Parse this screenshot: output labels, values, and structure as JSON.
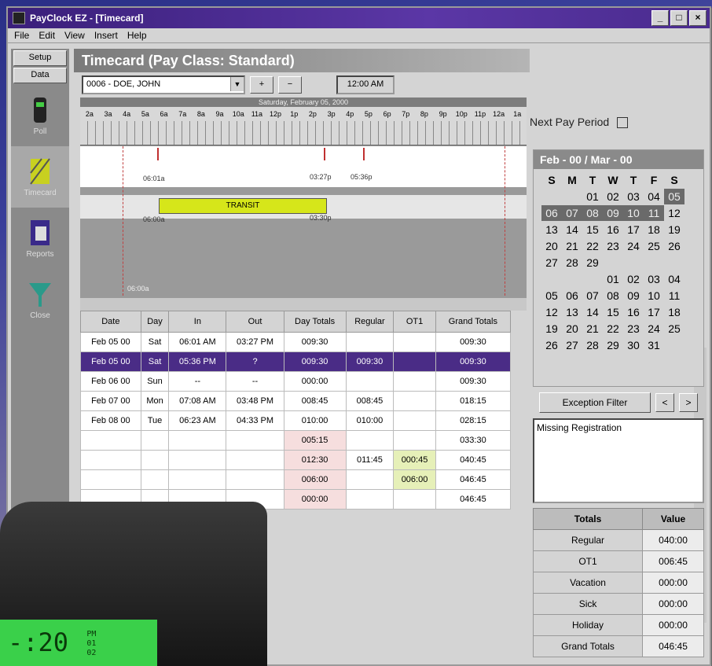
{
  "window": {
    "title": "PayClock EZ - [Timecard]"
  },
  "menu": [
    "File",
    "Edit",
    "View",
    "Insert",
    "Help"
  ],
  "nav": {
    "setup": "Setup",
    "data": "Data",
    "items": [
      {
        "label": "Poll",
        "icon": "clock-device-icon"
      },
      {
        "label": "Timecard",
        "icon": "timecard-icon"
      },
      {
        "label": "Reports",
        "icon": "reports-icon"
      },
      {
        "label": "Close",
        "icon": "close-funnel-icon"
      }
    ]
  },
  "panel": {
    "title": "Timecard (Pay Class: Standard)",
    "employee": "0006 - DOE, JOHN",
    "add_btn": "+",
    "remove_btn": "−",
    "time": "12:00 AM",
    "next_pay_period": "Next Pay Period"
  },
  "timeline": {
    "date": "Saturday, February 05, 2000",
    "hours": [
      "2a",
      "3a",
      "4a",
      "5a",
      "6a",
      "7a",
      "8a",
      "9a",
      "10a",
      "11a",
      "12p",
      "1p",
      "2p",
      "3p",
      "4p",
      "5p",
      "6p",
      "7p",
      "8p",
      "9p",
      "10p",
      "11p",
      "12a",
      "1a"
    ],
    "in1": "06:01a",
    "out1": "03:27p",
    "punch2": "05:36p",
    "transit_label": "TRANSIT",
    "transit_start": "06:00a",
    "transit_end": "03:30p",
    "start": "06:00a"
  },
  "grid": {
    "columns": [
      "Date",
      "Day",
      "In",
      "Out",
      "Day Totals",
      "Regular",
      "OT1",
      "Grand Totals"
    ],
    "rows": [
      {
        "date": "Feb 05 00",
        "day": "Sat",
        "in": "06:01 AM",
        "out": "03:27 PM",
        "total": "009:30",
        "reg": "",
        "ot1": "",
        "grand": "009:30"
      },
      {
        "date": "Feb 05 00",
        "day": "Sat",
        "in": "05:36 PM",
        "out": "?",
        "total": "009:30",
        "reg": "009:30",
        "ot1": "",
        "grand": "009:30"
      },
      {
        "date": "Feb 06 00",
        "day": "Sun",
        "in": "--",
        "out": "--",
        "total": "000:00",
        "reg": "",
        "ot1": "",
        "grand": "009:30"
      },
      {
        "date": "Feb 07 00",
        "day": "Mon",
        "in": "07:08 AM",
        "out": "03:48 PM",
        "total": "008:45",
        "reg": "008:45",
        "ot1": "",
        "grand": "018:15"
      },
      {
        "date": "Feb 08 00",
        "day": "Tue",
        "in": "06:23 AM",
        "out": "04:33 PM",
        "total": "010:00",
        "reg": "010:00",
        "ot1": "",
        "grand": "028:15"
      },
      {
        "date": "",
        "day": "",
        "in": "",
        "out": "",
        "total": "005:15",
        "reg": "",
        "ot1": "",
        "grand": "033:30"
      },
      {
        "date": "",
        "day": "",
        "in": "",
        "out": "",
        "total": "012:30",
        "reg": "011:45",
        "ot1": "000:45",
        "grand": "040:45"
      },
      {
        "date": "",
        "day": "",
        "in": "",
        "out": "",
        "total": "006:00",
        "reg": "",
        "ot1": "006:00",
        "grand": "046:45"
      },
      {
        "date": "",
        "day": "",
        "in": "",
        "out": "",
        "total": "000:00",
        "reg": "",
        "ot1": "",
        "grand": "046:45"
      }
    ]
  },
  "calendar": {
    "title": "Feb - 00 / Mar - 00",
    "dow": [
      "S",
      "M",
      "T",
      "W",
      "T",
      "F",
      "S"
    ],
    "feb": [
      "",
      "",
      "01",
      "02",
      "03",
      "04",
      "05",
      "06",
      "07",
      "08",
      "09",
      "10",
      "11",
      "12",
      "13",
      "14",
      "15",
      "16",
      "17",
      "18",
      "19",
      "20",
      "21",
      "22",
      "23",
      "24",
      "25",
      "26",
      "27",
      "28",
      "29",
      "",
      "",
      "",
      ""
    ],
    "mar": [
      "",
      "",
      "",
      "01",
      "02",
      "03",
      "04",
      "05",
      "06",
      "07",
      "08",
      "09",
      "10",
      "11",
      "12",
      "13",
      "14",
      "15",
      "16",
      "17",
      "18",
      "19",
      "20",
      "21",
      "22",
      "23",
      "24",
      "25",
      "26",
      "27",
      "28",
      "29",
      "30",
      "31",
      ""
    ]
  },
  "exception": {
    "button": "Exception Filter",
    "prev": "<",
    "next": ">",
    "items": [
      "Missing Registration"
    ]
  },
  "totals": {
    "headers": [
      "Totals",
      "Value"
    ],
    "rows": [
      {
        "label": "Regular",
        "value": "040:00"
      },
      {
        "label": "OT1",
        "value": "006:45"
      },
      {
        "label": "Vacation",
        "value": "000:00"
      },
      {
        "label": "Sick",
        "value": "000:00"
      },
      {
        "label": "Holiday",
        "value": "000:00"
      },
      {
        "label": "Grand Totals",
        "value": "046:45"
      }
    ]
  },
  "device": {
    "display": "-:20",
    "small": [
      "PM",
      "01",
      "02"
    ]
  },
  "colors": {
    "accent": "#4a2c86",
    "transit": "#d6e61a",
    "pink": "#f6dede",
    "lime": "#e6f0b8"
  }
}
